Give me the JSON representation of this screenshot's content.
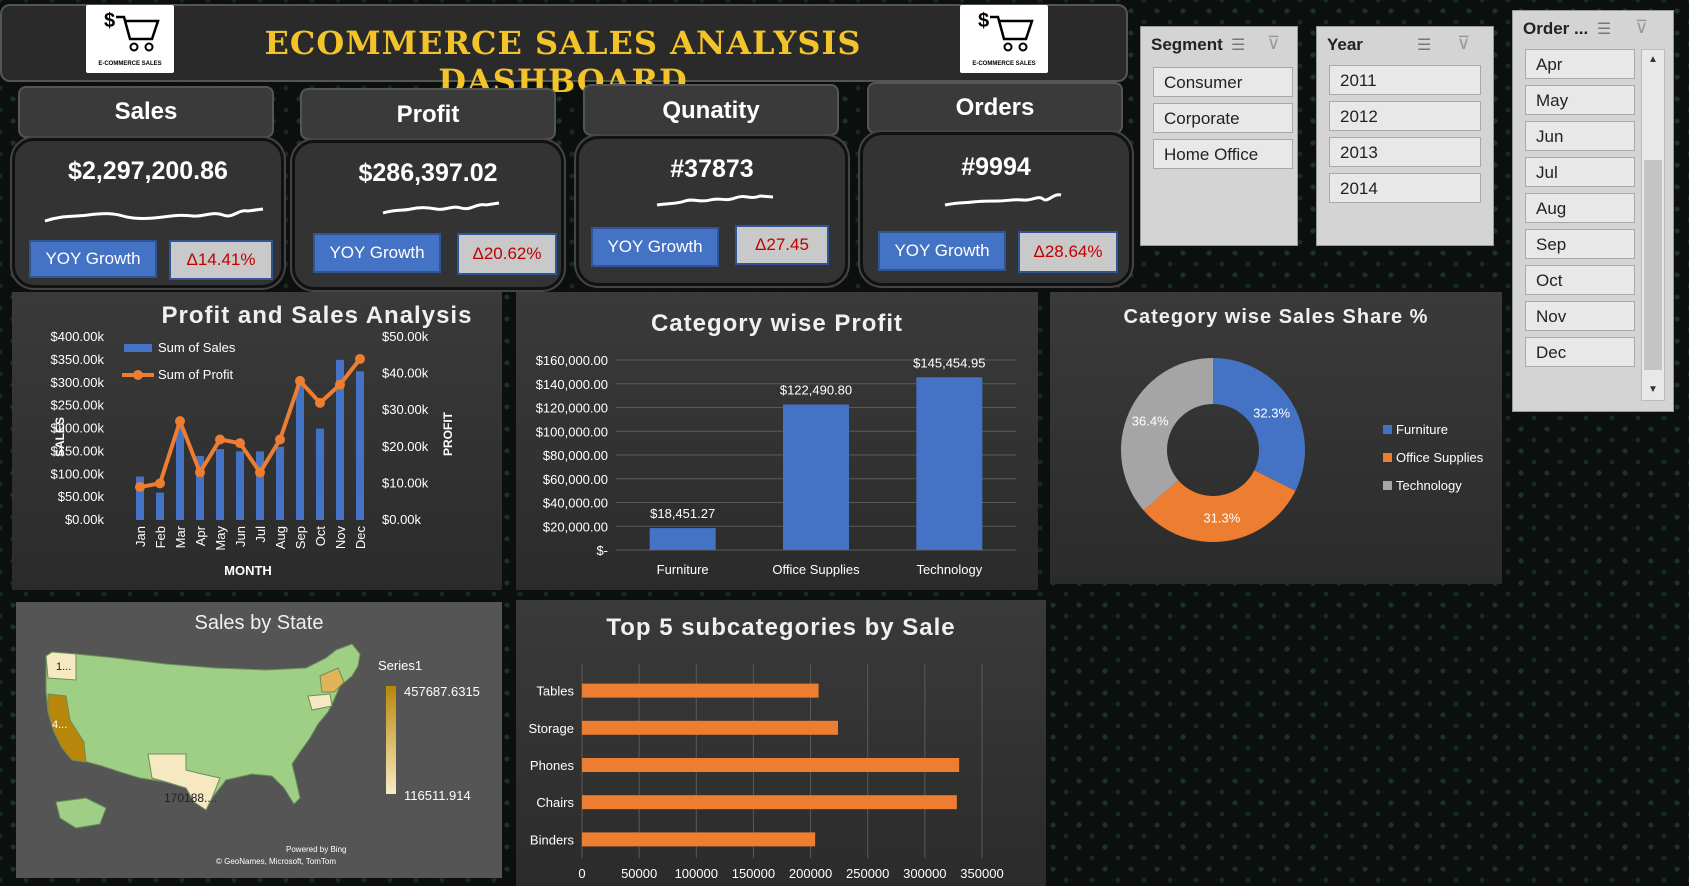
{
  "header": {
    "title": "ECOMMERCE SALES ANALYSIS DASHBOARD",
    "logo_caption": "E-COMMERCE SALES"
  },
  "kpis": [
    {
      "label": "Sales",
      "value": "$2,297,200.86",
      "yoy_label": "YOY Growth",
      "delta": "Δ14.41%"
    },
    {
      "label": "Profit",
      "value": "$286,397.02",
      "yoy_label": "YOY Growth",
      "delta": "Δ20.62%"
    },
    {
      "label": "Qunatity",
      "value": "#37873",
      "yoy_label": "YOY Growth",
      "delta": "Δ27.45"
    },
    {
      "label": "Orders",
      "value": "#9994",
      "yoy_label": "YOY Growth",
      "delta": "Δ28.64%"
    }
  ],
  "slicers": {
    "segment": {
      "title": "Segment",
      "items": [
        "Consumer",
        "Corporate",
        "Home Office"
      ]
    },
    "year": {
      "title": "Year",
      "items": [
        "2011",
        "2012",
        "2013",
        "2014"
      ]
    },
    "order": {
      "title": "Order ...",
      "items": [
        "Apr",
        "May",
        "Jun",
        "Jul",
        "Aug",
        "Sep",
        "Oct",
        "Nov",
        "Dec"
      ]
    }
  },
  "panels": {
    "profit_sales": "Profit and Sales Analysis",
    "category_profit": "Category wise Profit",
    "category_share": "Category wise Sales Share %",
    "sales_state": "Sales by State",
    "top5": "Top 5 subcategories by Sale"
  },
  "map": {
    "legend_title": "Series1",
    "max_label": "457687.6315",
    "min_label": "116511.914",
    "labels": [
      "1...",
      "4...",
      "170188...."
    ],
    "credit1": "Powered by Bing",
    "credit2": "© GeoNames, Microsoft, TomTom"
  },
  "chart_data": [
    {
      "type": "bar",
      "title": "Profit and Sales Analysis",
      "xlabel": "MONTH",
      "ylabel": "SALES",
      "y2label": "PROFIT",
      "categories": [
        "Jan",
        "Feb",
        "Mar",
        "Apr",
        "May",
        "Jun",
        "Jul",
        "Aug",
        "Sep",
        "Oct",
        "Nov",
        "Dec"
      ],
      "series": [
        {
          "name": "Sum of Sales",
          "type": "bar",
          "values": [
            95000,
            60000,
            205000,
            140000,
            155000,
            150000,
            150000,
            160000,
            305000,
            200000,
            350000,
            325000
          ]
        },
        {
          "name": "Sum of Profit",
          "type": "line",
          "values": [
            9000,
            10000,
            27000,
            13000,
            22000,
            21000,
            13000,
            22000,
            38000,
            32000,
            37000,
            44000
          ]
        }
      ],
      "y_ticks": [
        "$0.00k",
        "$50.00k",
        "$100.00k",
        "$150.00k",
        "$200.00k",
        "$250.00k",
        "$300.00k",
        "$350.00k",
        "$400.00k"
      ],
      "y2_ticks": [
        "$0.00k",
        "$10.00k",
        "$20.00k",
        "$30.00k",
        "$40.00k",
        "$50.00k"
      ],
      "ylim": [
        0,
        400000
      ],
      "y2lim": [
        0,
        50000
      ],
      "legend": "top-left",
      "colors": {
        "bar": "#4472c4",
        "line": "#ed7d31"
      }
    },
    {
      "type": "bar",
      "title": "Category wise Profit",
      "categories": [
        "Furniture",
        "Office Supplies",
        "Technology"
      ],
      "values": [
        18451.27,
        122490.8,
        145454.95
      ],
      "data_labels": [
        "$18,451.27",
        "$122,490.80",
        "$145,454.95"
      ],
      "y_ticks": [
        "$-",
        "$20,000.00",
        "$40,000.00",
        "$60,000.00",
        "$80,000.00",
        "$100,000.00",
        "$120,000.00",
        "$140,000.00",
        "$160,000.00"
      ],
      "ylim": [
        0,
        160000
      ],
      "color": "#4472c4"
    },
    {
      "type": "pie",
      "title": "Category wise Sales Share %",
      "categories": [
        "Furniture",
        "Office Supplies",
        "Technology"
      ],
      "values": [
        32.3,
        31.3,
        36.4
      ],
      "data_labels": [
        "32.3%",
        "31.3%",
        "36.4%"
      ],
      "colors": [
        "#4472c4",
        "#ed7d31",
        "#a5a5a5"
      ],
      "legend": "right"
    },
    {
      "type": "bar",
      "orientation": "horizontal",
      "title": "Top 5 subcategories by Sale",
      "categories": [
        "Tables",
        "Storage",
        "Phones",
        "Chairs",
        "Binders"
      ],
      "values": [
        207000,
        224000,
        330000,
        328000,
        204000
      ],
      "x_ticks": [
        "0",
        "50000",
        "100000",
        "150000",
        "200000",
        "250000",
        "300000",
        "350000"
      ],
      "xlim": [
        0,
        350000
      ],
      "color": "#ed7d31"
    }
  ]
}
